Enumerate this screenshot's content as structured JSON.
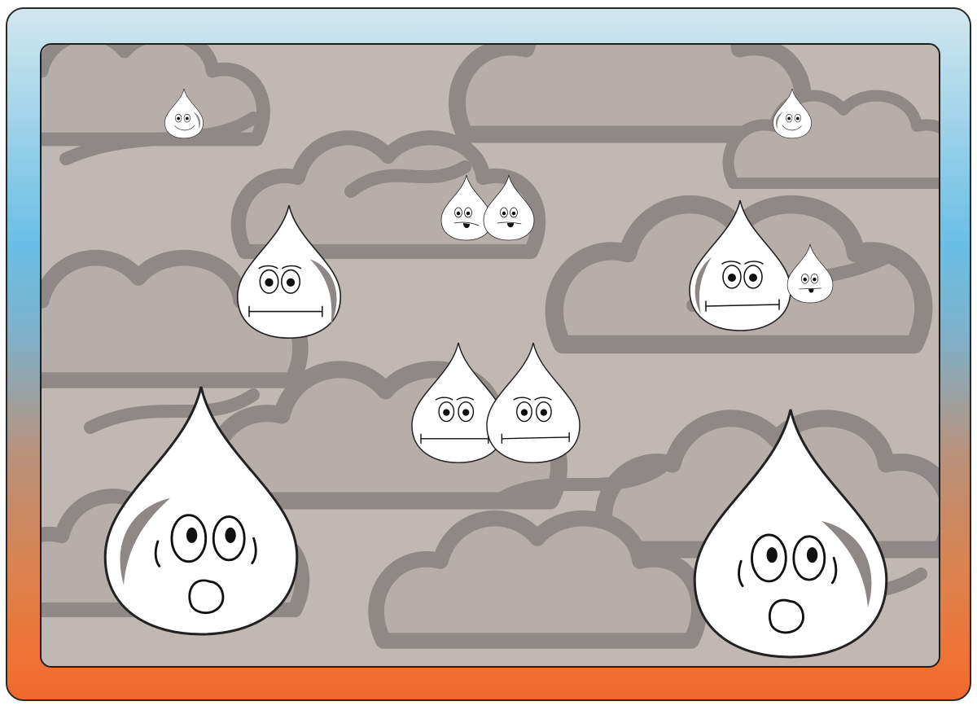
{
  "scene": {
    "frame_gradient": [
      "#d2e7ef",
      "#69bfe6",
      "#b8927d",
      "#f1692c"
    ],
    "cloud_background_color": "#c0b8b5",
    "cloud_outline_color": "#8e8886",
    "drop_color": "#ffffff"
  },
  "characters": [
    {
      "name": "raindrop-small-smiling",
      "expression": "smiling",
      "count": 2
    },
    {
      "name": "raindrop-small-pair",
      "expression": "tongue-out",
      "count": 1
    },
    {
      "name": "raindrop-medium",
      "expression": "worried",
      "count": 2
    },
    {
      "name": "raindrop-tiny",
      "expression": "tongue-out",
      "count": 1
    },
    {
      "name": "raindrop-medium-pair",
      "expression": "worried",
      "count": 1
    },
    {
      "name": "raindrop-large-surprised",
      "expression": "surprised",
      "count": 2
    }
  ]
}
